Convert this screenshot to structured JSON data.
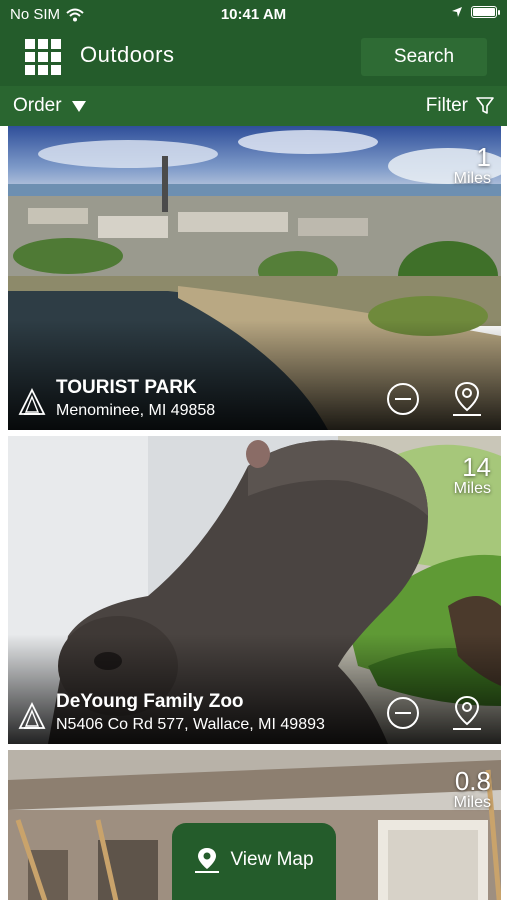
{
  "status_bar": {
    "carrier": "No SIM",
    "time": "10:41 AM"
  },
  "app_bar": {
    "title": "Outdoors",
    "search_label": "Search"
  },
  "toolbar": {
    "order_label": "Order",
    "filter_label": "Filter"
  },
  "places": [
    {
      "name": "TOURIST PARK",
      "address": "Menominee, MI 49858",
      "distance": "1",
      "distance_unit": "Miles"
    },
    {
      "name": "DeYoung Family Zoo",
      "address": "N5406 Co Rd 577, Wallace, MI 49893",
      "distance": "14",
      "distance_unit": "Miles"
    },
    {
      "name": "",
      "address": "",
      "distance": "0.8",
      "distance_unit": "Miles"
    }
  ],
  "view_map_label": "View Map",
  "colors": {
    "brand_green": "#245c2b",
    "bar_green": "#2a6630"
  }
}
